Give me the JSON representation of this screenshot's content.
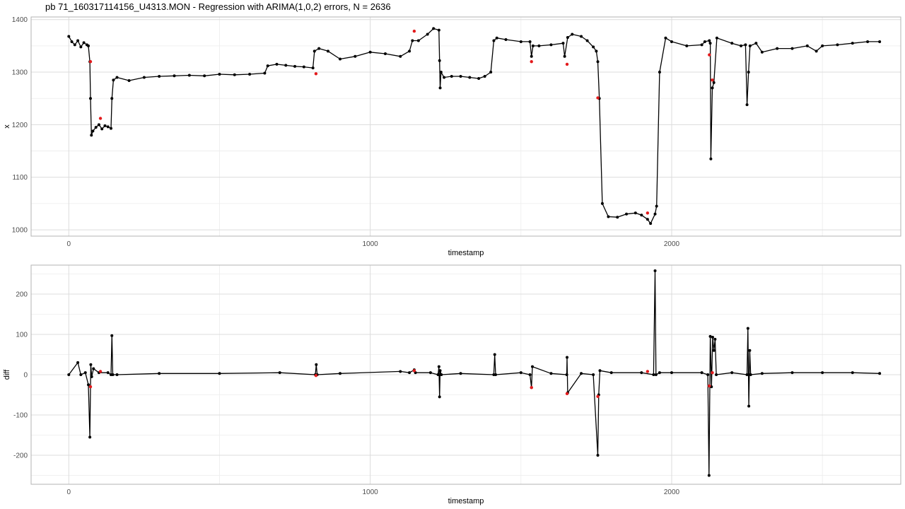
{
  "title": "pb 71_160317114156_U4313.MON - Regression with ARIMA(1,0,2) errors, N = 2636",
  "colors": {
    "background": "#ffffff",
    "grid_major": "#dcdcdc",
    "grid_minor": "#ececec",
    "border": "#b3b3b3",
    "series": "#000000",
    "outlier": "#e31a1c"
  },
  "chart_data": [
    {
      "type": "line",
      "xlabel": "timestamp",
      "ylabel": "x",
      "xlim": [
        -125,
        2760
      ],
      "ylim": [
        988,
        1405
      ],
      "x_ticks": [
        0,
        1000,
        2000
      ],
      "y_ticks": [
        1000,
        1100,
        1200,
        1300,
        1400
      ],
      "grid": true,
      "series": [
        {
          "x": [
            0,
            10,
            20,
            30,
            40,
            50,
            60,
            65,
            70,
            72,
            75,
            80,
            90,
            100,
            110,
            120,
            130,
            140,
            143,
            148,
            160,
            200,
            250,
            300,
            350,
            400,
            450,
            500,
            550,
            600,
            650,
            660,
            690,
            720,
            750,
            780,
            810,
            815,
            830,
            860,
            900,
            950,
            1000,
            1050,
            1100,
            1130,
            1140,
            1160,
            1190,
            1210,
            1228,
            1230,
            1232,
            1235,
            1245,
            1270,
            1300,
            1330,
            1360,
            1380,
            1400,
            1410,
            1420,
            1450,
            1500,
            1530,
            1535,
            1540,
            1560,
            1600,
            1640,
            1645,
            1655,
            1670,
            1700,
            1720,
            1740,
            1750,
            1755,
            1760,
            1770,
            1790,
            1820,
            1850,
            1880,
            1900,
            1920,
            1930,
            1945,
            1950,
            1960,
            1980,
            2000,
            2050,
            2100,
            2110,
            2125,
            2128,
            2130,
            2135,
            2140,
            2150,
            2200,
            2230,
            2245,
            2250,
            2255,
            2260,
            2280,
            2300,
            2350,
            2400,
            2450,
            2480,
            2500,
            2550,
            2600,
            2650,
            2690
          ],
          "y": [
            1368,
            1358,
            1352,
            1360,
            1348,
            1356,
            1352,
            1350,
            1320,
            1250,
            1180,
            1188,
            1195,
            1200,
            1192,
            1198,
            1196,
            1193,
            1250,
            1285,
            1290,
            1284,
            1290,
            1292,
            1293,
            1294,
            1293,
            1296,
            1295,
            1296,
            1298,
            1312,
            1315,
            1313,
            1311,
            1310,
            1308,
            1340,
            1345,
            1340,
            1325,
            1330,
            1338,
            1335,
            1330,
            1340,
            1360,
            1360,
            1372,
            1383,
            1380,
            1322,
            1270,
            1300,
            1290,
            1292,
            1292,
            1290,
            1288,
            1292,
            1300,
            1360,
            1365,
            1362,
            1358,
            1358,
            1330,
            1350,
            1350,
            1352,
            1355,
            1330,
            1366,
            1372,
            1368,
            1360,
            1348,
            1340,
            1320,
            1250,
            1050,
            1025,
            1024,
            1030,
            1032,
            1028,
            1020,
            1012,
            1030,
            1045,
            1300,
            1365,
            1358,
            1350,
            1352,
            1358,
            1360,
            1355,
            1135,
            1270,
            1280,
            1365,
            1355,
            1350,
            1352,
            1238,
            1300,
            1350,
            1355,
            1338,
            1345,
            1345,
            1350,
            1340,
            1350,
            1352,
            1355,
            1358,
            1358
          ]
        }
      ],
      "outliers": {
        "x": [
          72,
          105,
          820,
          1146,
          1535,
          1653,
          1755,
          1920,
          2125,
          2135
        ],
        "y": [
          1320,
          1212,
          1297,
          1378,
          1320,
          1315,
          1251,
          1032,
          1333,
          1285
        ]
      }
    },
    {
      "type": "line",
      "xlabel": "timestamp",
      "ylabel": "diff",
      "xlim": [
        -125,
        2760
      ],
      "ylim": [
        -272,
        272
      ],
      "x_ticks": [
        0,
        1000,
        2000
      ],
      "y_ticks": [
        -200,
        -100,
        0,
        100,
        200
      ],
      "grid": true,
      "series": [
        {
          "x": [
            0,
            30,
            40,
            55,
            65,
            70,
            73,
            76,
            82,
            100,
            130,
            140,
            143,
            146,
            160,
            300,
            500,
            700,
            818,
            821,
            824,
            900,
            1100,
            1130,
            1146,
            1150,
            1200,
            1225,
            1228,
            1230,
            1232,
            1236,
            1300,
            1410,
            1413,
            1416,
            1500,
            1530,
            1535,
            1538,
            1600,
            1652,
            1653,
            1655,
            1700,
            1740,
            1755,
            1758,
            1762,
            1800,
            1900,
            1940,
            1945,
            1948,
            1960,
            2000,
            2100,
            2120,
            2124,
            2128,
            2132,
            2136,
            2140,
            2144,
            2148,
            2200,
            2250,
            2253,
            2256,
            2259,
            2262,
            2300,
            2400,
            2500,
            2600,
            2690
          ],
          "y": [
            0,
            30,
            0,
            5,
            -25,
            -155,
            25,
            -5,
            15,
            5,
            5,
            0,
            97,
            0,
            0,
            3,
            3,
            5,
            0,
            25,
            0,
            3,
            8,
            5,
            12,
            5,
            5,
            0,
            20,
            -55,
            10,
            0,
            3,
            0,
            50,
            0,
            5,
            0,
            -32,
            20,
            3,
            0,
            43,
            -45,
            3,
            0,
            -200,
            -50,
            10,
            5,
            5,
            0,
            258,
            0,
            5,
            5,
            5,
            0,
            -250,
            95,
            -30,
            93,
            60,
            88,
            0,
            5,
            0,
            115,
            -78,
            60,
            0,
            3,
            5,
            5,
            5,
            3
          ]
        }
      ],
      "outliers": {
        "x": [
          72,
          105,
          820,
          1146,
          1535,
          1653,
          1755,
          1920,
          2125,
          2135
        ],
        "y": [
          -30,
          8,
          -2,
          10,
          -32,
          -47,
          -54,
          8,
          -28,
          5
        ]
      }
    }
  ]
}
